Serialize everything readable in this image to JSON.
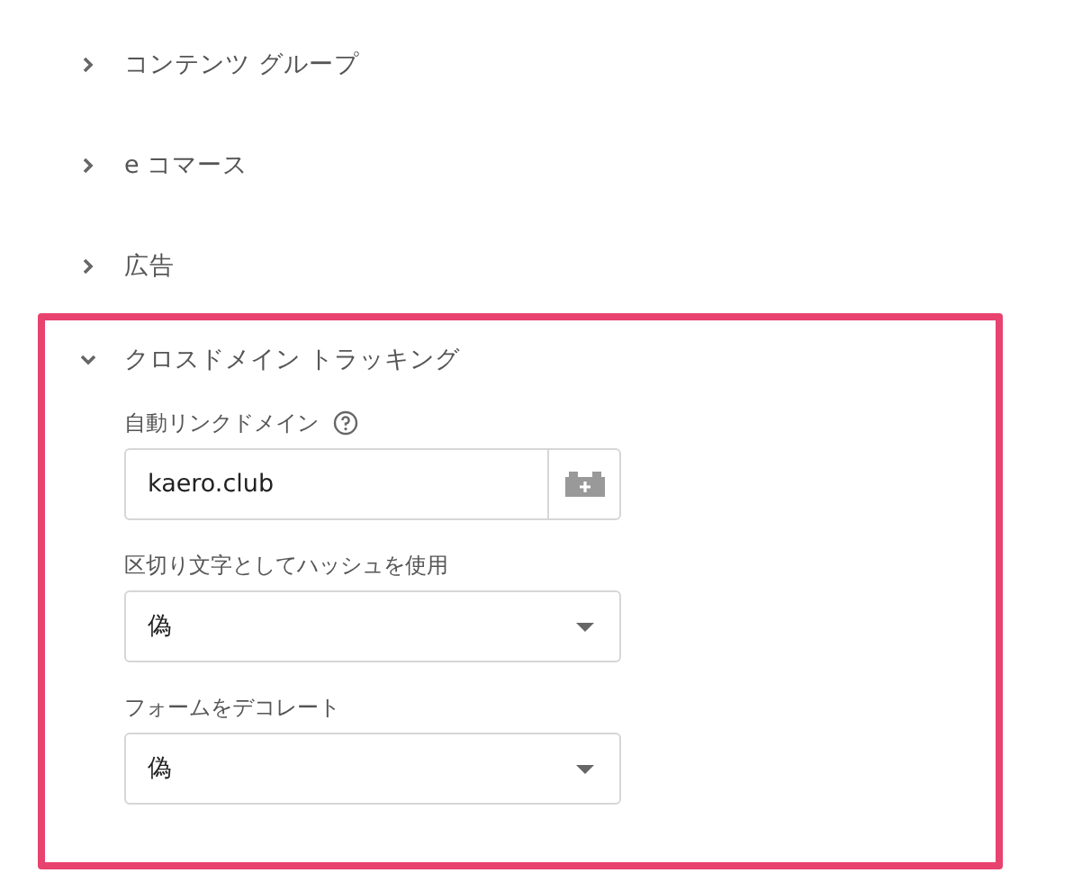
{
  "sections": [
    {
      "title": "コンテンツ グループ",
      "expanded": false,
      "highlighted": false
    },
    {
      "title": "e コマース",
      "expanded": false,
      "highlighted": false
    },
    {
      "title": "広告",
      "expanded": false,
      "highlighted": false
    },
    {
      "title": "クロスドメイン トラッキング",
      "expanded": true,
      "highlighted": true,
      "fields": [
        {
          "kind": "text",
          "label": "自動リンクドメイン",
          "help": true,
          "value": "kaero.club"
        },
        {
          "kind": "select",
          "label": "区切り文字としてハッシュを使用",
          "help": false,
          "value": "偽"
        },
        {
          "kind": "select",
          "label": "フォームをデコレート",
          "help": false,
          "value": "偽"
        }
      ]
    }
  ]
}
